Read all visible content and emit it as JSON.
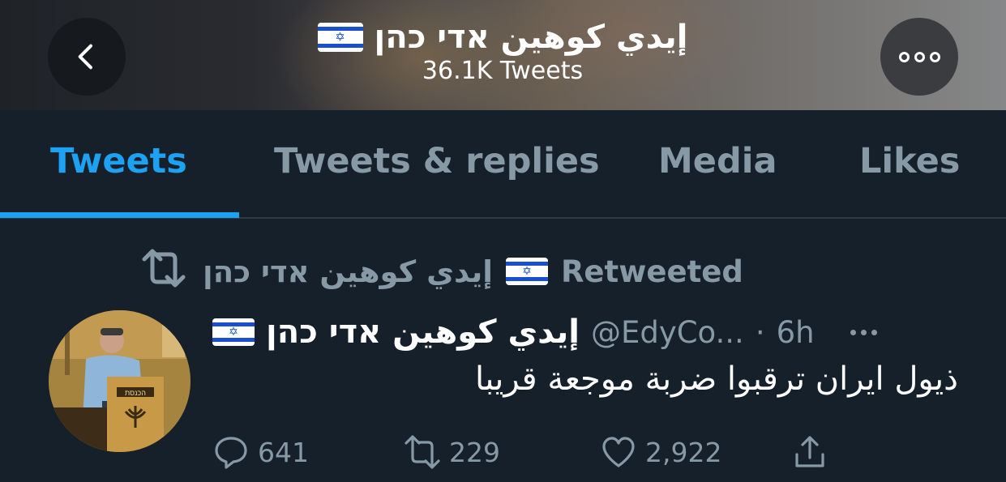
{
  "header": {
    "title": "إيدي كوهين אדי כהן",
    "tweet_count": "36.1K Tweets",
    "back_icon": "chevron-left-icon",
    "more_icon": "more-horizontal-icon"
  },
  "tabs": [
    {
      "label": "Tweets",
      "active": true
    },
    {
      "label": "Tweets & replies",
      "active": false
    },
    {
      "label": "Media",
      "active": false
    },
    {
      "label": "Likes",
      "active": false
    }
  ],
  "tweet": {
    "retweet_line": {
      "name": "إيدي كوهين אדי כהן",
      "label": "Retweeted"
    },
    "author_name": "إيدي كوهين אדי כהן",
    "handle": "@EdyCo...",
    "separator": "·",
    "time": "6h",
    "text": "ذيول ايران ترقبوا ضربة موجعة قريبا",
    "avatar_sign_text": "הכנסת",
    "actions": {
      "replies": "641",
      "retweets": "229",
      "likes": "2,922"
    }
  },
  "colors": {
    "background": "#15202b",
    "accent": "#1da1f2",
    "muted": "#8899a6",
    "flag_blue": "#1a4fd0"
  }
}
